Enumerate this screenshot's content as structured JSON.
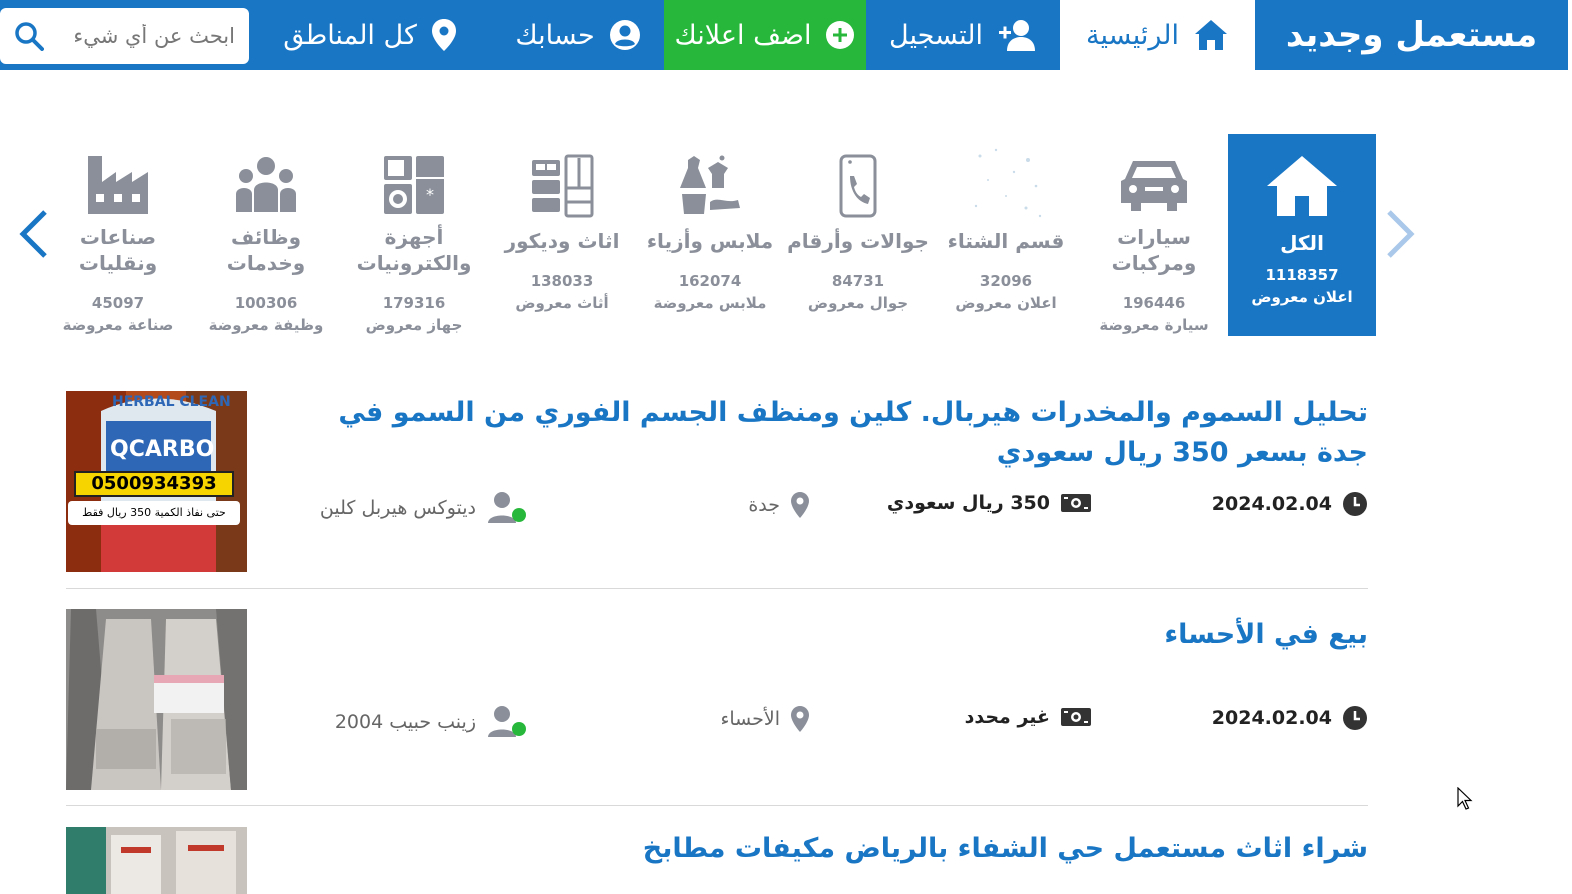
{
  "nav": {
    "logo": "مستعمل وجديد",
    "home": "الرئيسية",
    "register": "التسجيل",
    "add_ad": "اضف اعلانك",
    "account": "حسابك",
    "regions": "كل المناطق",
    "search_placeholder": "ابحث عن أي شيء"
  },
  "categories": [
    {
      "name": "الكل",
      "count": "1118357",
      "unit": "اعلان معروض",
      "icon": "home-icon",
      "active": true
    },
    {
      "name": "سيارات ومركبات",
      "count": "196446",
      "unit": "سيارة معروضة",
      "icon": "car-icon"
    },
    {
      "name": "قسم الشتاء",
      "count": "32096",
      "unit": "اعلان معروض",
      "icon": "snow-icon"
    },
    {
      "name": "جوالات وأرقام",
      "count": "84731",
      "unit": "جوال معروض",
      "icon": "phone-icon"
    },
    {
      "name": "ملابس وأزياء",
      "count": "162074",
      "unit": "ملابس معروضة",
      "icon": "clothes-icon"
    },
    {
      "name": "اثاث وديكور",
      "count": "138033",
      "unit": "أثاث معروض",
      "icon": "furniture-icon"
    },
    {
      "name": "أجهزة والكترونيات",
      "count": "179316",
      "unit": "جهاز معروض",
      "icon": "appliance-icon"
    },
    {
      "name": "وظائف وخدمات",
      "count": "100306",
      "unit": "وظيفة معروضة",
      "icon": "people-icon"
    },
    {
      "name": "صناعات ونقليات",
      "count": "45097",
      "unit": "صناعة معروضة",
      "icon": "factory-icon"
    }
  ],
  "listings": [
    {
      "title": "تحليل السموم والمخدرات هيربال. كلين ومنظف الجسم الفوري من السمو في جدة بسعر 350 ريال سعودي",
      "date": "2024.02.04",
      "price": "350 ريال سعودي",
      "location": "جدة",
      "user": "ديتوكس هيربل كلين",
      "thumb_text": {
        "brand": "HERBAL CLEAN",
        "product": "QCARBO",
        "phone": "0500934393",
        "price": "350",
        "price_note": "حتى نفاذ الكمية 350 ريال فقط"
      }
    },
    {
      "title": "بيع في الأحساء",
      "date": "2024.02.04",
      "price": "غير محدد",
      "location": "الأحساء",
      "user": "زينب حبيب 2004"
    },
    {
      "title": "شراء اثاث مستعمل حي الشفاء بالرياض مكيفات مطابخ"
    }
  ],
  "colors": {
    "brand": "#1976c5",
    "add": "#27b83b",
    "muted": "#8a8f99"
  }
}
